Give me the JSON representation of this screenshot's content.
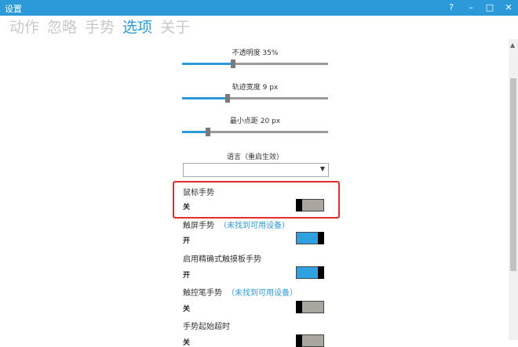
{
  "window": {
    "title": "设置",
    "help": "?",
    "minimize": "–",
    "maximize": "□",
    "close": "✕"
  },
  "tabs": [
    "动作",
    "忽略",
    "手势",
    "选项",
    "关于"
  ],
  "active_tab": 3,
  "sliders": [
    {
      "label": "不透明度 35%",
      "value_fraction": 0.35
    },
    {
      "label": "轨迹宽度 9 px",
      "value_fraction": 0.31
    },
    {
      "label": "最小点距 20 px",
      "value_fraction": 0.18
    }
  ],
  "language": {
    "label": "语言（重启生效）",
    "value": ""
  },
  "options": [
    {
      "label": "鼠标手势",
      "note": "",
      "state": "关",
      "on": false
    },
    {
      "label": "触屏手势",
      "note": "（未找到可用设备）",
      "state": "开",
      "on": true
    },
    {
      "label": "启用精确式触摸板手势",
      "note": "",
      "state": "开",
      "on": true
    },
    {
      "label": "触控笔手势",
      "note": "（未找到可用设备）",
      "state": "关",
      "on": false
    },
    {
      "label": "手势起始超时",
      "note": "",
      "state": "关",
      "on": false
    }
  ],
  "colors": {
    "accent": "#2c9ad8",
    "highlight": "#e22b2b"
  }
}
